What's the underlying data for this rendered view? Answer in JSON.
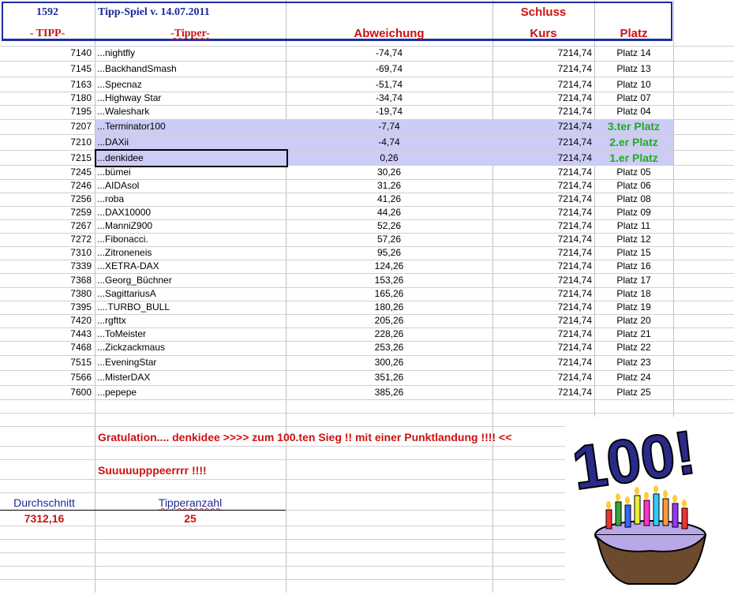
{
  "header": {
    "id": "1592",
    "title": "Tipp-Spiel v. 14.07.2011",
    "schluss": "Schluss",
    "col_tipp": "- TIPP-",
    "col_tipper": "-Tipper-",
    "col_abw": "Abweichung",
    "col_kurs": "Kurs",
    "col_platz": "Platz"
  },
  "rows": [
    {
      "tipp": "7140",
      "name": "...nightfly",
      "abw": "-74,74",
      "kurs": "7214,74",
      "platz": "Platz 14"
    },
    {
      "tipp": "7145",
      "name": "...BackhandSmash",
      "abw": "-69,74",
      "kurs": "7214,74",
      "platz": "Platz 13"
    },
    {
      "tipp": "7163",
      "name": "...Specnaz",
      "abw": "-51,74",
      "kurs": "7214,74",
      "platz": "Platz 10"
    },
    {
      "tipp": "7180",
      "name": "...Highway Star",
      "abw": "-34,74",
      "kurs": "7214,74",
      "platz": "Platz 07"
    },
    {
      "tipp": "7195",
      "name": "...Waleshark",
      "abw": "-19,74",
      "kurs": "7214,74",
      "platz": "Platz 04"
    },
    {
      "tipp": "7207",
      "name": "...Terminator100",
      "abw": "-7,74",
      "kurs": "7214,74",
      "platz": "3.ter Platz"
    },
    {
      "tipp": "7210",
      "name": "...DAXii",
      "abw": "-4,74",
      "kurs": "7214,74",
      "platz": "2.er Platz"
    },
    {
      "tipp": "7215",
      "name": "...denkidee",
      "abw": "0,26",
      "kurs": "7214,74",
      "platz": "1.er Platz"
    },
    {
      "tipp": "7245",
      "name": "...bümei",
      "abw": "30,26",
      "kurs": "7214,74",
      "platz": "Platz 05"
    },
    {
      "tipp": "7246",
      "name": "...AIDAsol",
      "abw": "31,26",
      "kurs": "7214,74",
      "platz": "Platz 06"
    },
    {
      "tipp": "7256",
      "name": "...roba",
      "abw": "41,26",
      "kurs": "7214,74",
      "platz": "Platz 08"
    },
    {
      "tipp": "7259",
      "name": "...DAX10000",
      "abw": "44,26",
      "kurs": "7214,74",
      "platz": "Platz 09"
    },
    {
      "tipp": "7267",
      "name": "...ManniZ900",
      "abw": "52,26",
      "kurs": "7214,74",
      "platz": "Platz 11"
    },
    {
      "tipp": "7272",
      "name": "...Fibonacci.",
      "abw": "57,26",
      "kurs": "7214,74",
      "platz": "Platz 12"
    },
    {
      "tipp": "7310",
      "name": "...Zitroneneis",
      "abw": "95,26",
      "kurs": "7214,74",
      "platz": "Platz 15"
    },
    {
      "tipp": "7339",
      "name": "...XETRA-DAX",
      "abw": "124,26",
      "kurs": "7214,74",
      "platz": "Platz 16"
    },
    {
      "tipp": "7368",
      "name": "...Georg_Büchner",
      "abw": "153,26",
      "kurs": "7214,74",
      "platz": "Platz 17"
    },
    {
      "tipp": "7380",
      "name": "...SagittariusA",
      "abw": "165,26",
      "kurs": "7214,74",
      "platz": "Platz 18"
    },
    {
      "tipp": "7395",
      "name": "....TURBO_BULL",
      "abw": "180,26",
      "kurs": "7214,74",
      "platz": "Platz 19"
    },
    {
      "tipp": "7420",
      "name": "...rgfttx",
      "abw": "205,26",
      "kurs": "7214,74",
      "platz": "Platz 20"
    },
    {
      "tipp": "7443",
      "name": "...ToMeister",
      "abw": "228,26",
      "kurs": "7214,74",
      "platz": "Platz 21"
    },
    {
      "tipp": "7468",
      "name": "...Zickzackmaus",
      "abw": "253,26",
      "kurs": "7214,74",
      "platz": "Platz 22"
    },
    {
      "tipp": "7515",
      "name": "...EveningStar",
      "abw": "300,26",
      "kurs": "7214,74",
      "platz": "Platz 23"
    },
    {
      "tipp": "7566",
      "name": "...MisterDAX",
      "abw": "351,26",
      "kurs": "7214,74",
      "platz": "Platz 24"
    },
    {
      "tipp": "7600",
      "name": "...pepepe",
      "abw": "385,26",
      "kurs": "7214,74",
      "platz": "Platz 25"
    }
  ],
  "messages": {
    "gratulation": "Gratulation.... denkidee   >>>> zum 100.ten Sieg !! mit einer Punktlandung !!!! <<",
    "super": "Suuuuupppeerrrr   !!!!"
  },
  "summary": {
    "durchschnitt_label": "Durchschnitt",
    "durchschnitt": "7312,16",
    "anzahl_label": "Tipperanzahl",
    "anzahl": "25"
  },
  "clipart": {
    "text": "100!"
  }
}
